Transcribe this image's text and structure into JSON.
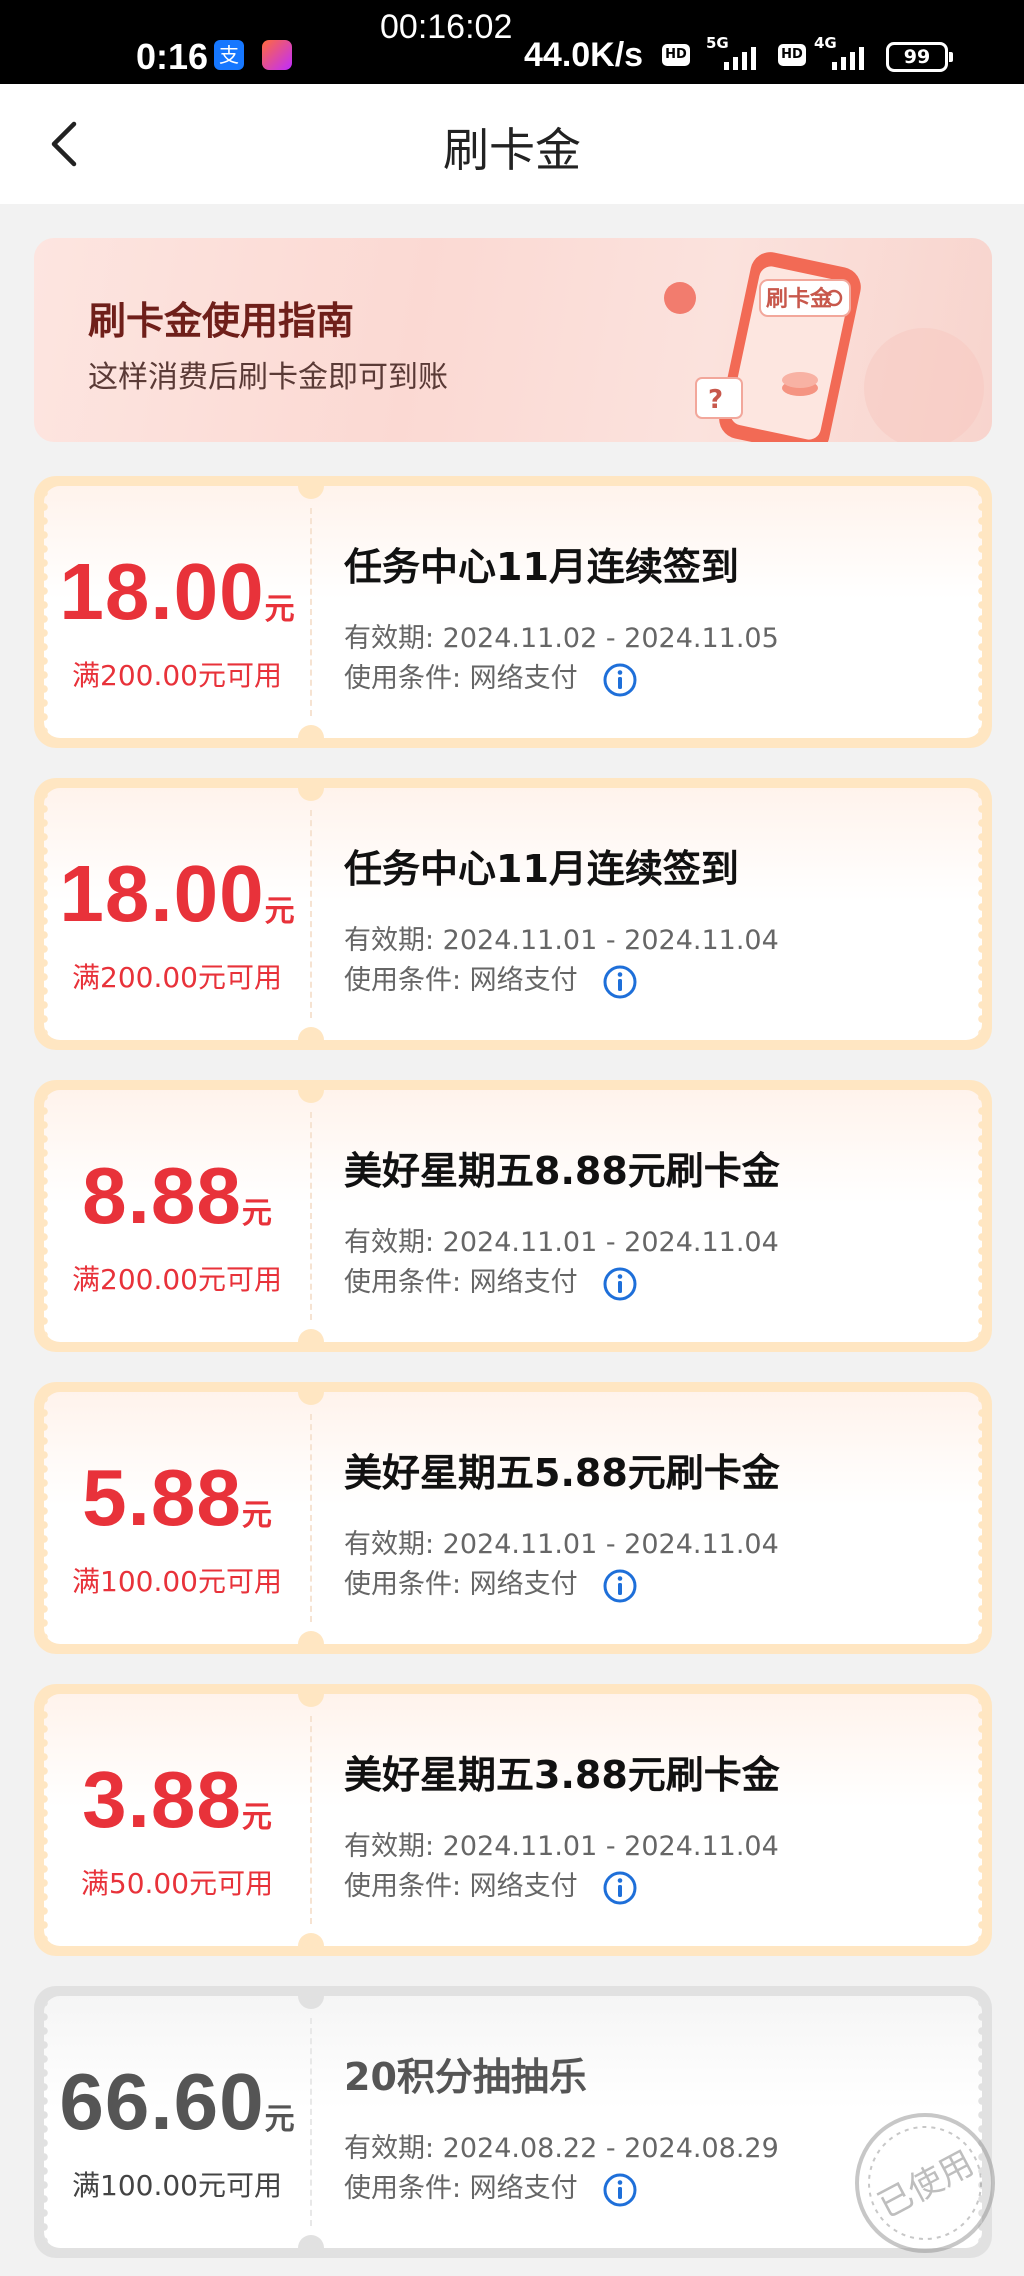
{
  "status_bar": {
    "time": "0:16",
    "center_clock": "00:16:02",
    "net_speed": "44.0K/s",
    "hd_label": "HD",
    "gen1": "5G",
    "gen2": "4G",
    "battery": "99",
    "app1_glyph": "支"
  },
  "nav": {
    "title": "刷卡金"
  },
  "guide": {
    "title": "刷卡金使用指南",
    "subtitle": "这样消费后刷卡金即可到账",
    "phone_label": "刷卡金"
  },
  "coupons": [
    {
      "amount": "18.00",
      "unit": "元",
      "min_spend": "满200.00元可用",
      "title": "任务中心11月连续签到",
      "validity": "有效期: 2024.11.02 - 2024.11.05",
      "usage": "使用条件:  网络支付",
      "status": "active"
    },
    {
      "amount": "18.00",
      "unit": "元",
      "min_spend": "满200.00元可用",
      "title": "任务中心11月连续签到",
      "validity": "有效期: 2024.11.01 - 2024.11.04",
      "usage": "使用条件:  网络支付",
      "status": "active"
    },
    {
      "amount": "8.88",
      "unit": "元",
      "min_spend": "满200.00元可用",
      "title": "美好星期五8.88元刷卡金",
      "validity": "有效期: 2024.11.01 - 2024.11.04",
      "usage": "使用条件:  网络支付",
      "status": "active"
    },
    {
      "amount": "5.88",
      "unit": "元",
      "min_spend": "满100.00元可用",
      "title": "美好星期五5.88元刷卡金",
      "validity": "有效期: 2024.11.01 - 2024.11.04",
      "usage": "使用条件:  网络支付",
      "status": "active"
    },
    {
      "amount": "3.88",
      "unit": "元",
      "min_spend": "满50.00元可用",
      "title": "美好星期五3.88元刷卡金",
      "validity": "有效期: 2024.11.01 - 2024.11.04",
      "usage": "使用条件:  网络支付",
      "status": "active"
    },
    {
      "amount": "66.60",
      "unit": "元",
      "min_spend": "满100.00元可用",
      "title": "20积分抽抽乐",
      "validity": "有效期: 2024.08.22 - 2024.08.29",
      "usage": "使用条件:  网络支付",
      "status": "used"
    }
  ],
  "used_stamp": {
    "text": "已使用"
  },
  "colors": {
    "accent_red": "#e8323a",
    "coupon_border": "#ffe6c2",
    "used_gray": "#555555",
    "info_blue": "#1e6fd9",
    "status_bar_bg": "#000000"
  },
  "icons": {
    "back": "chevron-left-icon",
    "info": "info-icon",
    "stamp": "used-stamp-icon"
  }
}
